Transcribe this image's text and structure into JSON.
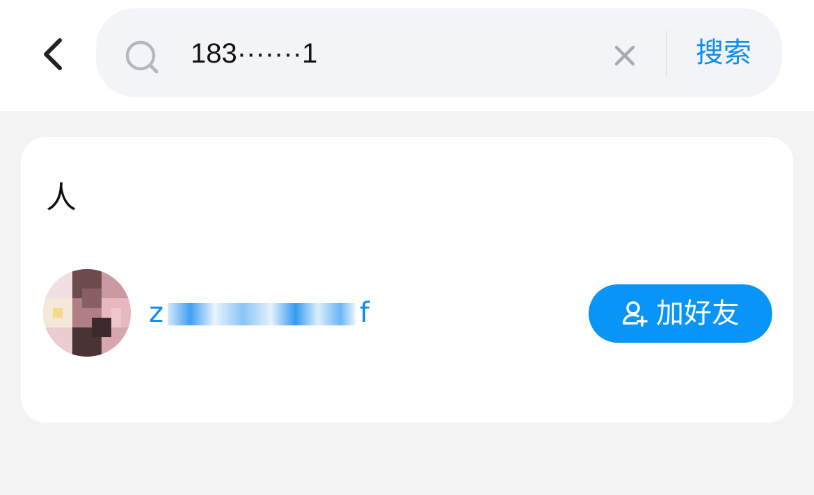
{
  "header": {
    "back_icon": "chevron-left-icon",
    "search": {
      "value": "183·······1",
      "placeholder": "",
      "search_icon": "search-icon",
      "clear_icon": "close-icon"
    },
    "search_button_label": "搜索"
  },
  "results": {
    "section_title": "人",
    "people": [
      {
        "name_prefix": "z",
        "name_suffix": "f",
        "add_button_label": "加好友",
        "add_button_icon": "add-user-icon"
      }
    ]
  },
  "colors": {
    "accent": "#0895f7",
    "link": "#0b8ef0",
    "page_bg": "#f3f3f3",
    "search_bg": "#f3f4f8"
  }
}
